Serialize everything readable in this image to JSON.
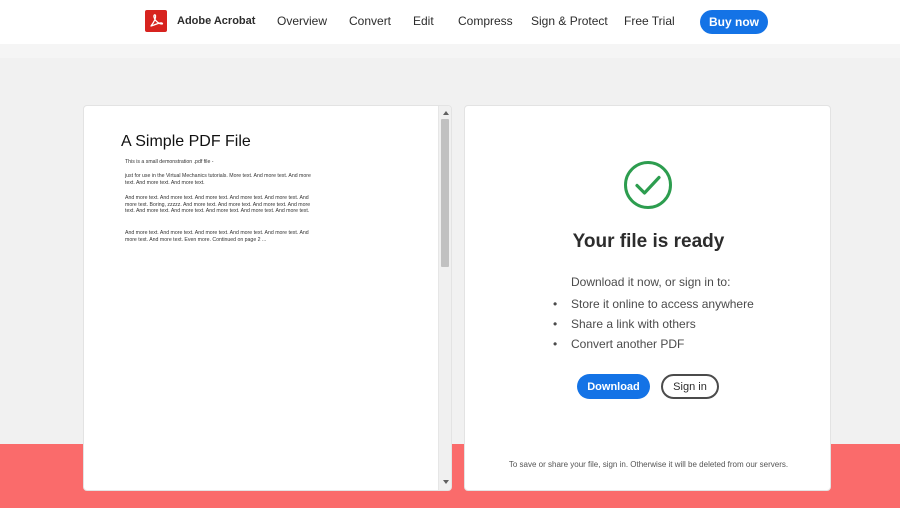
{
  "header": {
    "brand_name": "Adobe Acrobat",
    "logo_icon": "acrobat-logo-icon",
    "nav_items": [
      "Overview",
      "Convert",
      "Edit",
      "Compress",
      "Sign & Protect",
      "Free Trial"
    ],
    "buy_label": "Buy now"
  },
  "preview": {
    "title": "A Simple PDF File",
    "paragraphs": [
      "This is a small demonstration .pdf file -",
      "just for use in the Virtual Mechanics tutorials. More text. And more text. And more text. And more text. And more text.",
      "And more text. And more text. And more text. And more text. And more text. And more text. Boring, zzzzz. And more text. And more text. And more text. And more text. And more text. And more text. And more text. And more text. And more text.",
      "And more text. And more text. And more text. And more text. And more text. And more text. And more text. Even more. Continued on page 2 ..."
    ]
  },
  "result": {
    "status_icon": "check-circle-icon",
    "title": "Your file is ready",
    "intro": "Download it now, or sign in to:",
    "bullets": [
      "Store it online to access anywhere",
      "Share a link with others",
      "Convert another PDF"
    ],
    "download_label": "Download",
    "signin_label": "Sign in",
    "footnote": "To save or share your file, sign in. Otherwise it will be deleted from our servers."
  },
  "colors": {
    "accent_blue": "#1473e6",
    "success_green": "#2d9d4f",
    "coral_band": "#fa6b6b",
    "acrobat_red": "#d7231f"
  }
}
